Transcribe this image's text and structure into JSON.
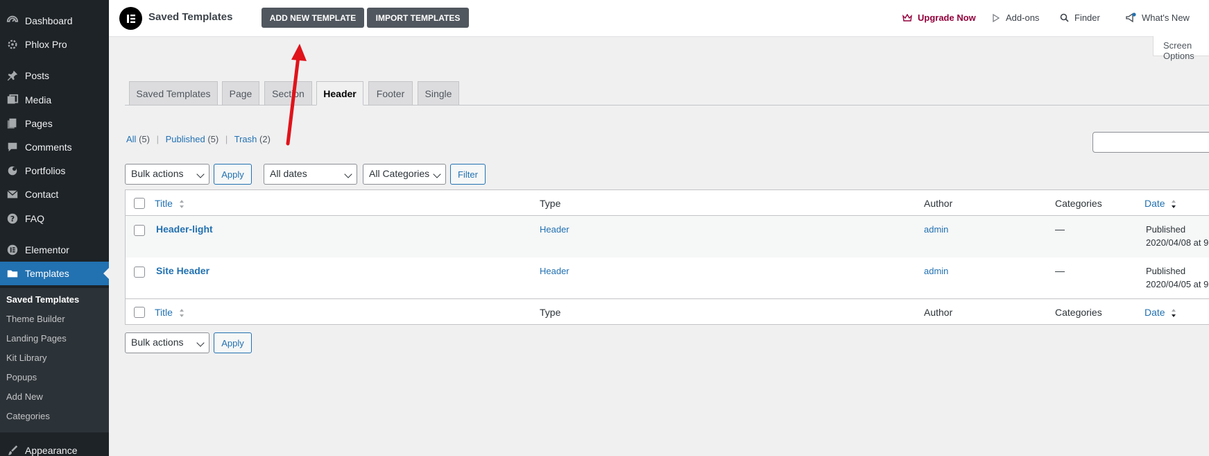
{
  "sidebar": {
    "items": [
      {
        "label": "Dashboard",
        "icon": "dashboard-icon"
      },
      {
        "label": "Phlox Pro",
        "icon": "gear-icon"
      },
      {
        "label": "Posts",
        "icon": "pin-icon"
      },
      {
        "label": "Media",
        "icon": "media-icon"
      },
      {
        "label": "Pages",
        "icon": "pages-icon"
      },
      {
        "label": "Comments",
        "icon": "comment-icon"
      },
      {
        "label": "Portfolios",
        "icon": "portfolio-icon"
      },
      {
        "label": "Contact",
        "icon": "mail-icon"
      },
      {
        "label": "FAQ",
        "icon": "help-icon"
      },
      {
        "label": "Elementor",
        "icon": "elementor-icon"
      },
      {
        "label": "Templates",
        "icon": "folder-icon"
      },
      {
        "label": "Appearance",
        "icon": "brush-icon"
      }
    ],
    "submenu": [
      "Saved Templates",
      "Theme Builder",
      "Landing Pages",
      "Kit Library",
      "Popups",
      "Add New",
      "Categories"
    ]
  },
  "topbar": {
    "title": "Saved Templates",
    "add_new": "ADD NEW TEMPLATE",
    "import": "IMPORT TEMPLATES",
    "upgrade": "Upgrade Now",
    "addons": "Add-ons",
    "finder": "Finder",
    "whats_new": "What's New",
    "screen_options": "Screen Options"
  },
  "tabs": [
    "Saved Templates",
    "Page",
    "Section",
    "Header",
    "Footer",
    "Single"
  ],
  "views": {
    "all": "All",
    "all_count": "(5)",
    "published": "Published",
    "published_count": "(5)",
    "trash": "Trash",
    "trash_count": "(2)",
    "separator": "|"
  },
  "filters": {
    "bulk_actions": "Bulk actions",
    "apply": "Apply",
    "all_dates": "All dates",
    "all_categories": "All Categories",
    "filter": "Filter"
  },
  "table": {
    "columns": {
      "title": "Title",
      "type": "Type",
      "author": "Author",
      "categories": "Categories",
      "date": "Date"
    },
    "rows": [
      {
        "title": "Header-light",
        "type": "Header",
        "author": "admin",
        "categories": "—",
        "status": "Published",
        "date": "2020/04/08 at 9"
      },
      {
        "title": "Site Header",
        "type": "Header",
        "author": "admin",
        "categories": "—",
        "status": "Published",
        "date": "2020/04/05 at 9"
      }
    ]
  },
  "colors": {
    "accent": "#2271b1",
    "sidebar": "#1d2327",
    "annotation": "#e0131a"
  }
}
